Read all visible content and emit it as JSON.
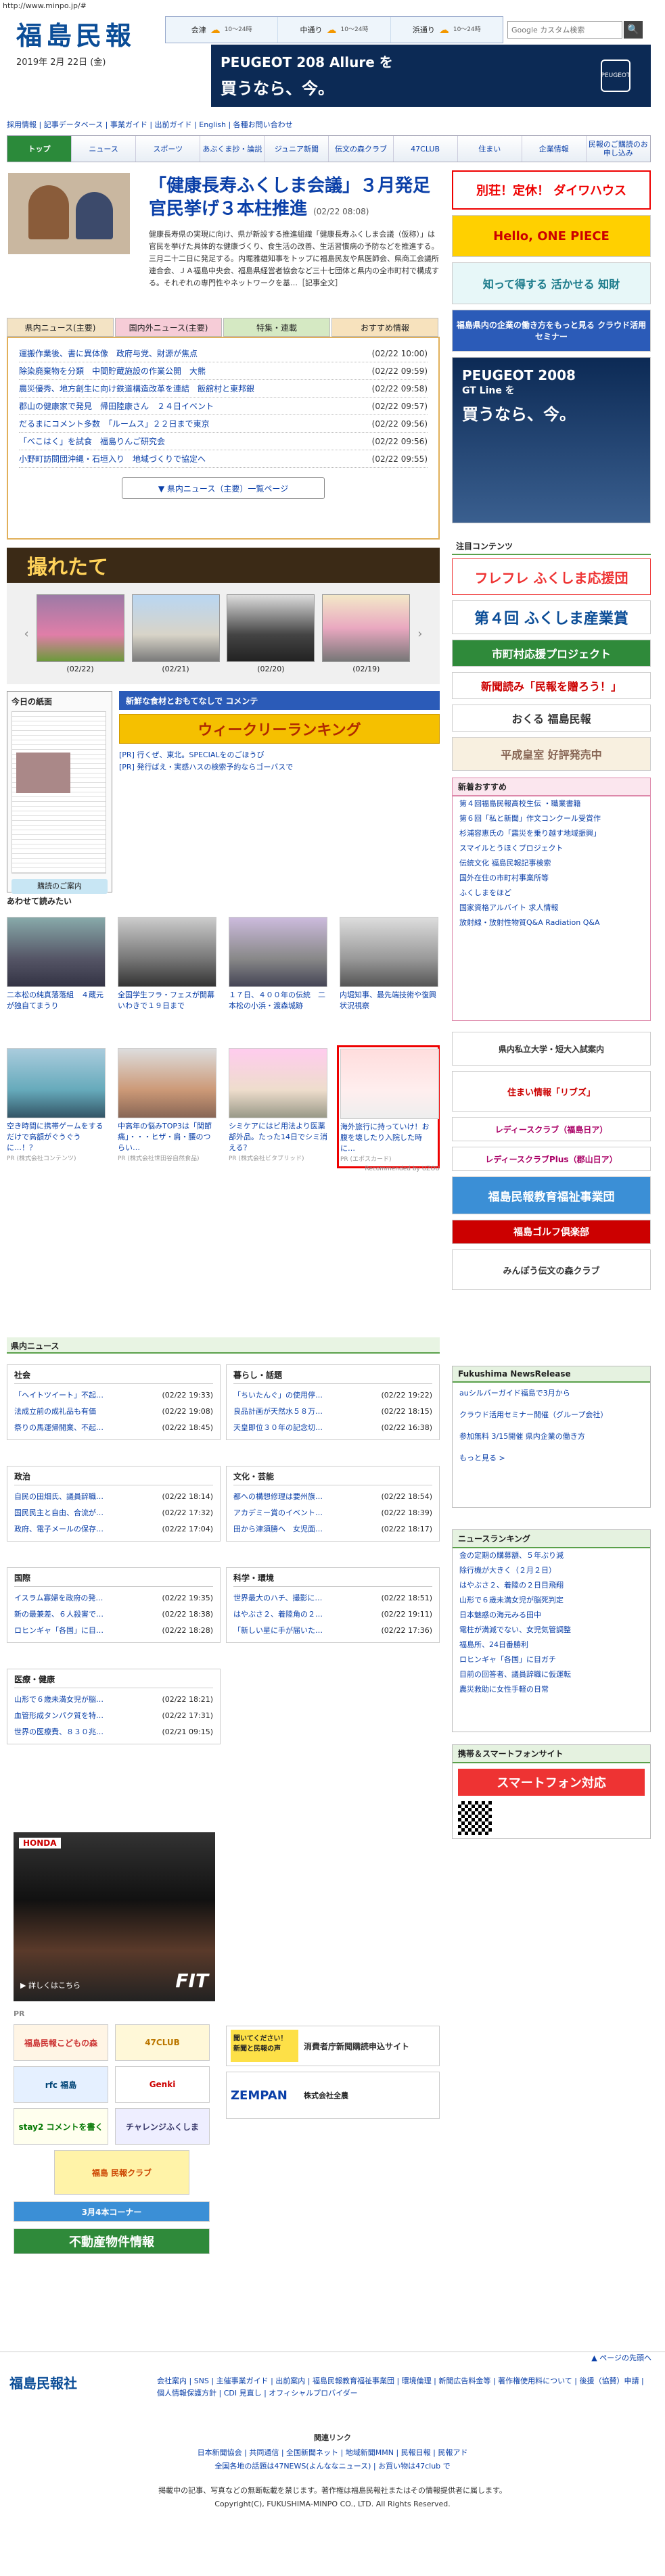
{
  "url": "http://www.minpo.jp/#",
  "site": {
    "logo": "福島民報",
    "date": "2019年 2月 22日 (金)"
  },
  "weather": [
    {
      "area": "会津",
      "icon": "cloud-icon",
      "temp": "10〜24時"
    },
    {
      "area": "中通り",
      "icon": "cloud-icon",
      "temp": "10〜24時"
    },
    {
      "area": "浜通り",
      "icon": "cloud-icon",
      "temp": "10〜24時"
    }
  ],
  "search": {
    "placeholder": "Google カスタム検索",
    "button": "🔍"
  },
  "ad_top": {
    "line1": "PEUGEOT 208 Allure を",
    "line2": "買うなら、今。",
    "brand": "PEUGEOT"
  },
  "sublinks": "採用情報 | 記事データベース | 事業ガイド | 出前ガイド | English | 各種お問い合わせ",
  "nav": [
    "トップ",
    "ニュース",
    "スポーツ",
    "あぶくま抄・論説",
    "ジュニア新聞",
    "伝文の森クラブ",
    "47CLUB",
    "住まい",
    "企業情報",
    "民報のご購読のお申し込み"
  ],
  "top": {
    "headline": "「健康長寿ふくしま会議」３月発足 官民挙げ３本柱推進",
    "date": "(02/22 08:08)",
    "body": "健康長寿県の実現に向け、県が新設する推進組織「健康長寿ふくしま会議（仮称）」は官民を挙げた具体的な健康づくり、食生活の改善、生活習慣病の予防などを推進する。三月二十二日に発足する。内堀雅雄知事をトップに福島民友や県医師会、県商工会議所連合会、ＪＡ福島中央会、福島県経営者協会など三十七団体と県内の全市町村で構成する。それぞれの専門性やネットワークを基…［記事全文］"
  },
  "tabs": [
    "県内ニュース(主要)",
    "国内外ニュース(主要)",
    "特集・連載",
    "おすすめ情報"
  ],
  "news": [
    {
      "title": "運搬作業後、書に異体像　政府与党、財源が焦点",
      "date": "(02/22 10:00)"
    },
    {
      "title": "除染廃棄物を分類　中間貯蔵施設の作業公開　大熊",
      "date": "(02/22 09:59)"
    },
    {
      "title": "農災優秀、地方創生に向け鉄道構造改革を連結　飯舘村と東邦銀",
      "date": "(02/22 09:58)"
    },
    {
      "title": "郡山の健康家で発見　帰田陸康さん　２４日イベント",
      "date": "(02/22 09:57)"
    },
    {
      "title": "だるまにコメント多数　「ルームス」２２日まで東京",
      "date": "(02/22 09:56)"
    },
    {
      "title": "「べこはく」を試食　福島りんご研究会",
      "date": "(02/22 09:56)"
    },
    {
      "title": "小野町訪問団沖縄・石垣入り　地域づくりで協定へ",
      "date": "(02/22 09:55)"
    }
  ],
  "news_more": "▼ 県内ニュース（主要）一覧ページ",
  "toretate": {
    "label": "撮れたて",
    "photos": [
      "(02/22)",
      "(02/21)",
      "(02/20)",
      "(02/19)"
    ]
  },
  "paper": {
    "label": "今日の紙面",
    "button": "購読のご案内"
  },
  "midads": {
    "ad1": "新鮮な食材とおもてなしで コメンテ",
    "ad2": "ウィークリーランキング",
    "links": [
      "[PR] 行くぜ、東北。SPECIALをのごほうび",
      "[PR] 発行ばえ・実感ハスの検索予約ならゴーバスで"
    ]
  },
  "recommend": {
    "title": "あわせて読みたい",
    "items": [
      {
        "text": "二本松の純真落落組　４蔵元が独自てまうり",
        "sponsor": ""
      },
      {
        "text": "全国学生フラ・フェスが開幕　いわきで１９日まで",
        "sponsor": ""
      },
      {
        "text": "１７日、４００年の伝統　二本松の小浜・渡森城跡",
        "sponsor": ""
      },
      {
        "text": "内堀知事、最先端技術や復興状況視察",
        "sponsor": ""
      },
      {
        "text": "空き時間に携帯ゲームをするだけで高額がぐうぐうに…！？",
        "sponsor": "PR (株式会社コンテンツ)"
      },
      {
        "text": "中高年の悩みTOP3は「関節痛」・・・ヒザ・肩・腰のつらい…",
        "sponsor": "PR (株式会社世田谷自然食品)"
      },
      {
        "text": "シミケアにはビ用法より医薬部外品。たった14日でシミ消える？",
        "sponsor": "PR (株式会社ビタブリッド)"
      },
      {
        "text": "海外旅行に持っていけ！お腹を壊したり入院した時に…",
        "sponsor": "PR (エポスカード)"
      }
    ],
    "credit": "Recommended by UZOU"
  },
  "kennai": "県内ニュース",
  "cats": [
    {
      "name": "社会",
      "rows": [
        {
          "t": "「ヘイトツイート」不起…",
          "d": "(02/22 19:33)"
        },
        {
          "t": "法成立前の成礼品も有価",
          "d": "(02/22 19:08)"
        },
        {
          "t": "祭りの馬運帰開業、不起…",
          "d": "(02/22 18:45)"
        }
      ]
    },
    {
      "name": "暮らし・話題",
      "rows": [
        {
          "t": "「ちいたんぐ」の使用停…",
          "d": "(02/22 19:22)"
        },
        {
          "t": "良品計画が天然水５８万…",
          "d": "(02/22 18:15)"
        },
        {
          "t": "天皇即位３０年の記念切…",
          "d": "(02/22 16:38)"
        }
      ]
    },
    {
      "name": "政治",
      "rows": [
        {
          "t": "自民の田畑氏、議員辞職…",
          "d": "(02/22 18:14)"
        },
        {
          "t": "国民民主と自由、合流が…",
          "d": "(02/22 17:32)"
        },
        {
          "t": "政府、電子メールの保存…",
          "d": "(02/22 17:04)"
        }
      ]
    },
    {
      "name": "文化・芸能",
      "rows": [
        {
          "t": "都への構想修理は要州旗…",
          "d": "(02/22 18:54)"
        },
        {
          "t": "アカデミー賞のイベント…",
          "d": "(02/22 18:39)"
        },
        {
          "t": "田から津須勝へ　女児面…",
          "d": "(02/22 18:17)"
        }
      ]
    },
    {
      "name": "国際",
      "rows": [
        {
          "t": "イスラム寡婦を政府の発…",
          "d": "(02/22 19:35)"
        },
        {
          "t": "新の最兼差、６人殺害で…",
          "d": "(02/22 18:38)"
        },
        {
          "t": "ロヒンギャ「各国」に目…",
          "d": "(02/22 18:28)"
        }
      ]
    },
    {
      "name": "科学・環境",
      "rows": [
        {
          "t": "世界最大のハチ、撮影に…",
          "d": "(02/22 18:51)"
        },
        {
          "t": "はやぶさ２、着陸角の２…",
          "d": "(02/22 19:11)"
        },
        {
          "t": "「新しい星に手が届いた…",
          "d": "(02/22 17:36)"
        }
      ]
    },
    {
      "name": "医療・健康",
      "rows": [
        {
          "t": "山形で６歳未満女児が脳…",
          "d": "(02/22 18:21)"
        },
        {
          "t": "血管形成タンパク質を特…",
          "d": "(02/22 17:31)"
        },
        {
          "t": "世界の医療費、８３０兆…",
          "d": "(02/21 09:15)"
        }
      ]
    }
  ],
  "honda": {
    "brand": "HONDA",
    "link": "▶ 詳しくはこちら",
    "model": "FIT"
  },
  "pr": {
    "label": "PR",
    "tiles": [
      "福島民報こどもの森",
      "47CLUB",
      "rfc 福島",
      "Genki",
      "stay2 コメントを書く",
      "チャレンジふくしま",
      "福島 民報クラブ",
      "3月4本コーナー",
      "不動産物件情報"
    ]
  },
  "pr2": {
    "t1": "聞いてください！ 新聞と民報の声",
    "t2": "消費者庁新聞購読申込サイト",
    "t3": "ZEMPAN",
    "t4": "株式会社全農"
  },
  "right": {
    "ads": [
      "別荘！定休！ ダイワハウス",
      "Hello, ONE PIECE",
      "知って得する 活かせる 知財",
      "福島県内の企業の働き方をもっと見る クラウド活用セミナー"
    ],
    "peugeot": {
      "line1": "PEUGEOT 2008",
      "line2": "GT Line を",
      "line3": "買うなら、今。"
    },
    "chumoku": "注目コンテンツ",
    "banners": [
      "フレフレ ふくしま応援団",
      "第４回 ふくしま産業賞",
      "市町村応援プロジェクト",
      "新聞読み「民報を贈ろう！」",
      "おくる 福島民報",
      "平成皇室 好評発売中"
    ],
    "osusume_title": "新着おすすめ",
    "osusume": [
      "第４回福島民報高校生伝 ・職業書籍",
      "第６回「私と新聞」作文コンクール受賞作",
      "杉浦容恵氏の「震災を乗り越す地域振興」",
      "スマイルとうほくプロジェクト",
      "伝統文化 福島民報記事検索",
      "国外在住の市町村事業所等",
      "ふくしまをほど",
      "国家資格アルバイト 求人情報",
      "放射線・放射性物質Q&A Radiation Q&A"
    ],
    "box2": [
      "県内私立大学・短大入試案内",
      "住まい情報「リブズ」",
      "レディースクラブ（福島日ア）",
      "レディースクラブPlus（郡山日ア）",
      "福島民報教育福祉事業団",
      "福島ゴルフ倶楽部",
      "みんぽう伝文の森クラブ"
    ],
    "newsrelease": {
      "title": "Fukushima NewsRelease",
      "items": [
        "auシルバーガイド福島で3月から",
        "クラウド活用セミナー開催（グループ会社）",
        "参加無料 3/15開催 県内企業の働き方",
        "もっと見る >"
      ]
    },
    "ranking": {
      "title": "ニュースランキング",
      "items": [
        "金の定期の購募額、５年ぶり減",
        "除行機が大きく（２月２日）",
        "はやぶさ２、着陸の２日目飛翔",
        "山形で６歳未満女児が脳死判定",
        "日本魅惑の海元みる田中",
        "電柱が満減でない、女児気管調整",
        "福島所、24日番勝利",
        "ロヒンギャ「各国」に目ガチ",
        "目前の回答者、議員辞職に仮運転",
        "農災救助に女性手軽の日常"
      ]
    },
    "smartphone": {
      "title": "携帯＆スマートフォンサイト",
      "banner": "スマートフォン対応"
    }
  },
  "footer": {
    "pagetop": "▲ ページの先頭へ",
    "logo": "福島民報社",
    "links": "会社案内 | SNS | 主催事業ガイド | 出前案内 | 福島民報教育福祉事業団 | 環境倫理 | 新聞広告料金等 | 著作権使用料について | 後援（協賛）申請 | 個人情報保護方針 | CDI 見直し | オフィシャルプロバイダー",
    "related_title": "関連リンク",
    "related": "日本新聞協会 | 共同通信 | 全国新聞ネット | 地域新聞MMN | 民報日報 | 民報アド",
    "related2": "全国各地の話題は47NEWS(よんななニュース) | お買い物は47club で",
    "notice": "掲載中の記事、写真などの無断転載を禁じます。著作権は福島民報社またはその情報提供者に属します。",
    "copyright": "Copyright(C), FUKUSHIMA-MINPO CO., LTD. All Rights Reserved."
  }
}
